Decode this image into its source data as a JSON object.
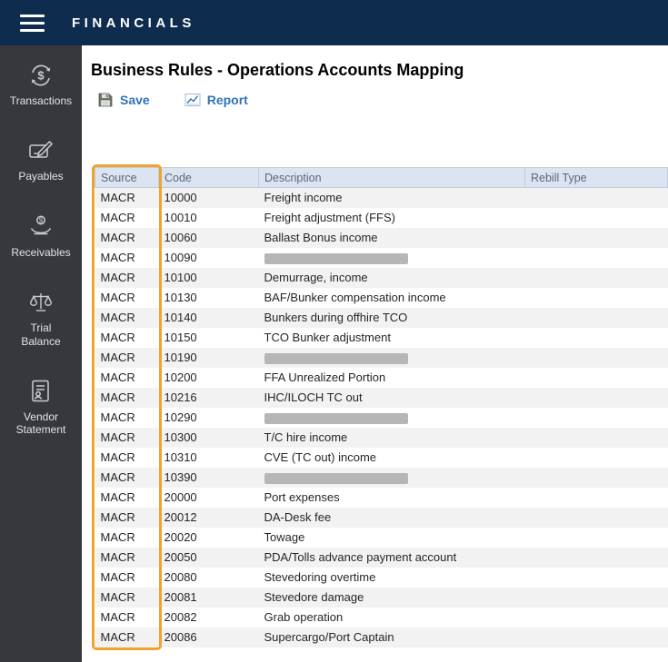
{
  "topbar": {
    "title": "FINANCIALS",
    "menu_icon": "hamburger-menu-icon"
  },
  "sidebar": {
    "items": [
      {
        "label": "Transactions",
        "icon": "transactions-icon"
      },
      {
        "label": "Payables",
        "icon": "payables-icon"
      },
      {
        "label": "Receivables",
        "icon": "receivables-icon"
      },
      {
        "label": "Trial\nBalance",
        "icon": "trial-balance-icon"
      },
      {
        "label": "Vendor\nStatement",
        "icon": "vendor-statement-icon"
      }
    ]
  },
  "main": {
    "title": "Business Rules - Operations Accounts Mapping",
    "toolbar": {
      "save_label": "Save",
      "report_label": "Report"
    },
    "table": {
      "columns": [
        "Source",
        "Code",
        "Description",
        "Rebill Type"
      ],
      "highlight_color": "#f0a42f",
      "highlighted_column": "Source",
      "rows": [
        {
          "source": "MACR",
          "code": "10000",
          "description": "Freight income",
          "rebill": "",
          "redacted": false
        },
        {
          "source": "MACR",
          "code": "10010",
          "description": "Freight adjustment (FFS)",
          "rebill": "",
          "redacted": false
        },
        {
          "source": "MACR",
          "code": "10060",
          "description": "Ballast Bonus income",
          "rebill": "",
          "redacted": false
        },
        {
          "source": "MACR",
          "code": "10090",
          "description": "",
          "rebill": "",
          "redacted": true
        },
        {
          "source": "MACR",
          "code": "10100",
          "description": "Demurrage, income",
          "rebill": "",
          "redacted": false
        },
        {
          "source": "MACR",
          "code": "10130",
          "description": "BAF/Bunker compensation income",
          "rebill": "",
          "redacted": false
        },
        {
          "source": "MACR",
          "code": "10140",
          "description": "Bunkers during offhire TCO",
          "rebill": "",
          "redacted": false
        },
        {
          "source": "MACR",
          "code": "10150",
          "description": "TCO Bunker adjustment",
          "rebill": "",
          "redacted": false
        },
        {
          "source": "MACR",
          "code": "10190",
          "description": "",
          "rebill": "",
          "redacted": true
        },
        {
          "source": "MACR",
          "code": "10200",
          "description": "FFA Unrealized Portion",
          "rebill": "",
          "redacted": false
        },
        {
          "source": "MACR",
          "code": "10216",
          "description": "IHC/ILOCH TC out",
          "rebill": "",
          "redacted": false
        },
        {
          "source": "MACR",
          "code": "10290",
          "description": "",
          "rebill": "",
          "redacted": true
        },
        {
          "source": "MACR",
          "code": "10300",
          "description": "T/C hire income",
          "rebill": "",
          "redacted": false
        },
        {
          "source": "MACR",
          "code": "10310",
          "description": "CVE (TC out) income",
          "rebill": "",
          "redacted": false
        },
        {
          "source": "MACR",
          "code": "10390",
          "description": "",
          "rebill": "",
          "redacted": true
        },
        {
          "source": "MACR",
          "code": "20000",
          "description": "Port expenses",
          "rebill": "",
          "redacted": false
        },
        {
          "source": "MACR",
          "code": "20012",
          "description": "DA-Desk fee",
          "rebill": "",
          "redacted": false
        },
        {
          "source": "MACR",
          "code": "20020",
          "description": "Towage",
          "rebill": "",
          "redacted": false
        },
        {
          "source": "MACR",
          "code": "20050",
          "description": "PDA/Tolls advance payment account",
          "rebill": "",
          "redacted": false
        },
        {
          "source": "MACR",
          "code": "20080",
          "description": "Stevedoring overtime",
          "rebill": "",
          "redacted": false
        },
        {
          "source": "MACR",
          "code": "20081",
          "description": "Stevedore damage",
          "rebill": "",
          "redacted": false
        },
        {
          "source": "MACR",
          "code": "20082",
          "description": "Grab operation",
          "rebill": "",
          "redacted": false
        },
        {
          "source": "MACR",
          "code": "20086",
          "description": "Supercargo/Port Captain",
          "rebill": "",
          "redacted": false
        }
      ]
    }
  }
}
